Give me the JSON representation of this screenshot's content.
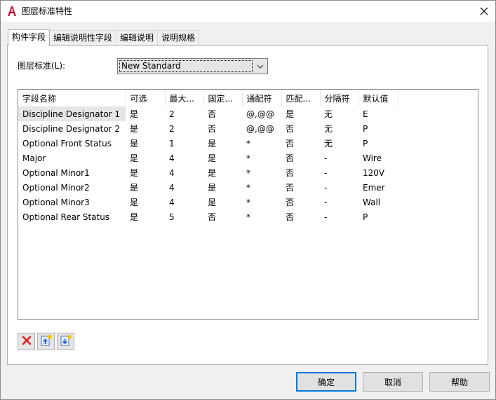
{
  "window": {
    "title": "图层标准特性",
    "icons": {
      "app": "autocad-a-icon",
      "close": "close-icon"
    },
    "accent": "#0078d7"
  },
  "tabs": [
    {
      "label": "构件字段",
      "active": true
    },
    {
      "label": "编辑说明性字段",
      "active": false
    },
    {
      "label": "编辑说明",
      "active": false
    },
    {
      "label": "说明规格",
      "active": false
    }
  ],
  "layer_standard": {
    "label": "图层标准(L):",
    "value": "New Standard"
  },
  "fields_table": {
    "columns": [
      "字段名称",
      "可选",
      "最大...",
      "固定...",
      "通配符",
      "匹配...",
      "分隔符",
      "默认值"
    ],
    "rows": [
      [
        "Discipline Designator 1",
        "是",
        "2",
        "否",
        "@,@@",
        "是",
        "无",
        "E"
      ],
      [
        "Discipline Designator 2",
        "是",
        "2",
        "否",
        "@,@@",
        "否",
        "无",
        "P"
      ],
      [
        "Optional Front Status",
        "是",
        "1",
        "是",
        "*",
        "否",
        "无",
        "P"
      ],
      [
        "Major",
        "是",
        "4",
        "是",
        "*",
        "否",
        "-",
        "Wire"
      ],
      [
        "Optional Minor1",
        "是",
        "4",
        "是",
        "*",
        "否",
        "-",
        "120V"
      ],
      [
        "Optional Minor2",
        "是",
        "4",
        "是",
        "*",
        "否",
        "-",
        "Emer"
      ],
      [
        "Optional Minor3",
        "是",
        "4",
        "是",
        "*",
        "否",
        "-",
        "Wall"
      ],
      [
        "Optional Rear Status",
        "是",
        "5",
        "否",
        "*",
        "否",
        "-",
        "P"
      ]
    ],
    "selected_row": 0
  },
  "toolbar_icons": [
    "delete-icon",
    "move-up-icon",
    "move-down-icon"
  ],
  "buttons": {
    "ok": "确定",
    "cancel": "取消",
    "help": "帮助"
  }
}
